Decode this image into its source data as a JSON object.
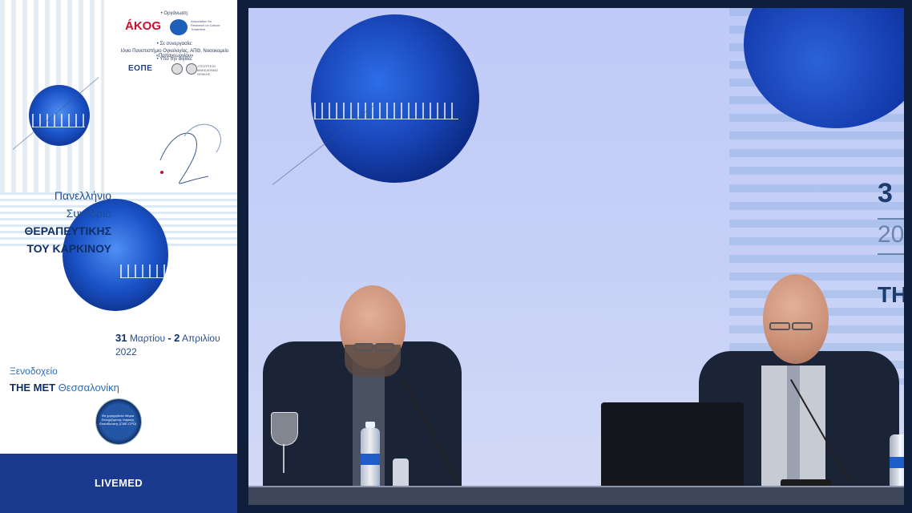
{
  "poster": {
    "organizer_label": "• Οργάνωση:",
    "org_logo": "ÁKOG",
    "org_logo_accent": "G",
    "org_sub_text": "Association for Research on Cancer Treatment",
    "partnership_label": "• Σε συνεργασία:",
    "partners": "Ιόνιο Πανεπιστήμιο Ογκολογίας, ΑΠΘ, Νοσοκομείο «Παπαγεωργίου»",
    "auspices_label": "• Υπό την αιγίδα:",
    "eope": "ΕΟΠΕ",
    "ministry_text": "ΥΠΟΥΡΓΕΙΟ ΜΑΚΕΔΟΝΙΑΣ ΘΡΑΚΗΣ",
    "title_line1": "Πανελλήνιο",
    "title_line2": "Συνέδριο",
    "title_line3": "ΘΕΡΑΠΕΥΤΙΚΗΣ",
    "title_line4": "ΤΟΥ ΚΑΡΚΙΝΟΥ",
    "date_start_day": "31",
    "date_start_month": "Μαρτίου",
    "date_sep": "-",
    "date_end_day": "2",
    "date_end_month": "Απριλίου",
    "year": "2022",
    "venue_line1": "Ξενοδοχείο",
    "venue_name": "THE MET",
    "venue_city": "Θεσσαλονίκη",
    "cme_text": "Θα χορηγηθούν Μόρια Συνεχιζόμενης Ιατρικής Εκπαίδευσης (CME-CPD)",
    "footer_brand": "LIVEMED"
  },
  "stage": {
    "screen_number": "3",
    "screen_year": "20",
    "screen_text": "TH"
  },
  "colors": {
    "brand_blue": "#1b3a8f",
    "title_blue": "#1d4e93",
    "screen_bg": "#c6d0f7",
    "orb_blue": "#1845b7"
  }
}
